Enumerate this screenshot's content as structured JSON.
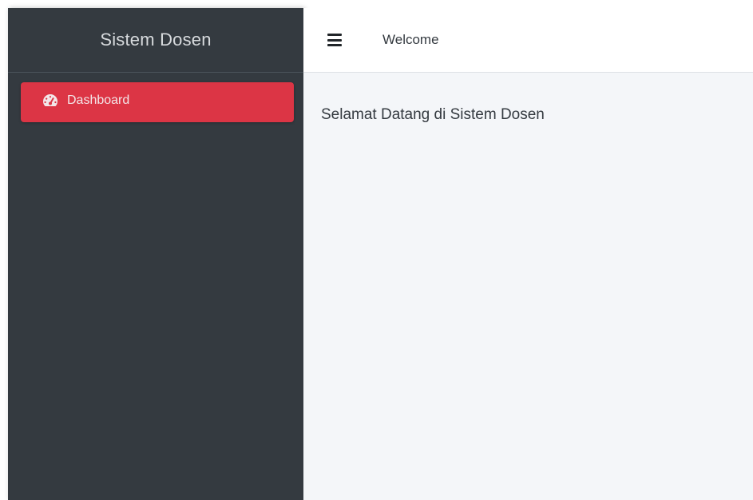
{
  "sidebar": {
    "brand": "Sistem Dosen",
    "items": [
      {
        "label": "Dashboard",
        "icon": "tachometer-icon",
        "active": true
      }
    ]
  },
  "topbar": {
    "menu_icon": "hamburger-icon",
    "title": "Welcome"
  },
  "content": {
    "message": "Selamat Datang di Sistem Dosen"
  },
  "colors": {
    "sidebar_bg": "#343a40",
    "active_item": "#dc3545",
    "content_bg": "#f4f6f9",
    "topbar_bg": "#ffffff"
  }
}
